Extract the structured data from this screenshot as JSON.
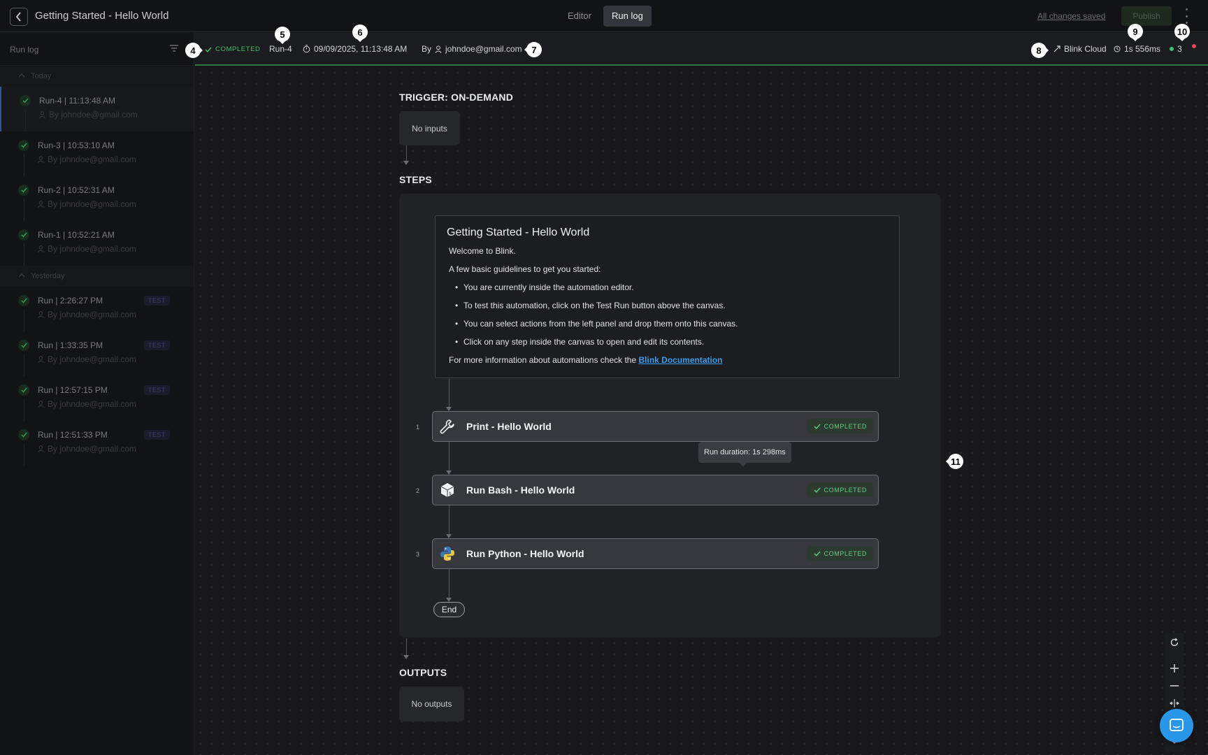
{
  "topbar": {
    "title": "Getting Started - Hello World",
    "tabs": [
      {
        "label": "Editor"
      },
      {
        "label": "Run log"
      }
    ],
    "saved_label": "All changes saved",
    "publish_label": "Publish"
  },
  "sidebar": {
    "title": "Run log",
    "groups": [
      {
        "label": "Today",
        "runs": [
          {
            "name": "Run-4  |  11:13:48 AM",
            "by": "By johndoe@gmail.com",
            "active": true
          },
          {
            "name": "Run-3  |  10:53:10 AM",
            "by": "By johndoe@gmail.com"
          },
          {
            "name": "Run-2  |  10:52:31 AM",
            "by": "By johndoe@gmail.com"
          },
          {
            "name": "Run-1  |  10:52:21 AM",
            "by": "By johndoe@gmail.com"
          }
        ]
      },
      {
        "label": "Yesterday",
        "runs": [
          {
            "name": "Run  |  2:26:27 PM",
            "by": "By johndoe@gmail.com",
            "badge": "TEST"
          },
          {
            "name": "Run  |  1:33:35 PM",
            "by": "By johndoe@gmail.com",
            "badge": "TEST"
          },
          {
            "name": "Run  |  12:57:15 PM",
            "by": "By johndoe@gmail.com",
            "badge": "TEST"
          },
          {
            "name": "Run  |  12:51:33 PM",
            "by": "By johndoe@gmail.com",
            "badge": "TEST"
          }
        ]
      }
    ]
  },
  "runbar": {
    "status": "COMPLETED",
    "run_id": "Run-4",
    "datetime": "09/09/2025, 11:13:48 AM",
    "by_label": "By",
    "user": "johndoe@gmail.com",
    "runner": "Blink Cloud",
    "duration": "1s 556ms",
    "success_count": "3"
  },
  "callouts": [
    "4",
    "5",
    "6",
    "7",
    "8",
    "9",
    "10",
    "11"
  ],
  "canvas": {
    "trigger_title": "TRIGGER: ON-DEMAND",
    "no_inputs": "No inputs",
    "steps_title": "STEPS",
    "note": {
      "title": "Getting Started - Hello World",
      "welcome": "Welcome to Blink.",
      "guidelines_intro": "A few basic guidelines to get you started:",
      "bullets": [
        "You are currently inside the automation editor.",
        "To test this automation, click on the Test Run button above the canvas.",
        "You can select actions from the left panel and drop them onto this canvas.",
        "Click on any step inside the canvas to open and edit its contents."
      ],
      "more_info": "For more information about automations check the ",
      "link": "Blink Documentation"
    },
    "steps": [
      {
        "num": "1",
        "title": "Print - Hello World",
        "status": "COMPLETED",
        "icon": "wrench-icon"
      },
      {
        "num": "2",
        "title": "Run Bash - Hello World",
        "status": "COMPLETED",
        "icon": "bash-cube-icon"
      },
      {
        "num": "3",
        "title": "Run Python - Hello World",
        "status": "COMPLETED",
        "icon": "python-icon"
      }
    ],
    "tooltip": "Run duration: 1s 298ms",
    "end_label": "End",
    "outputs_title": "OUTPUTS",
    "no_outputs": "No outputs"
  },
  "colors": {
    "success": "#43c06a",
    "accent": "#2a96e8",
    "link": "#3d9be9",
    "error": "#e5484d"
  }
}
